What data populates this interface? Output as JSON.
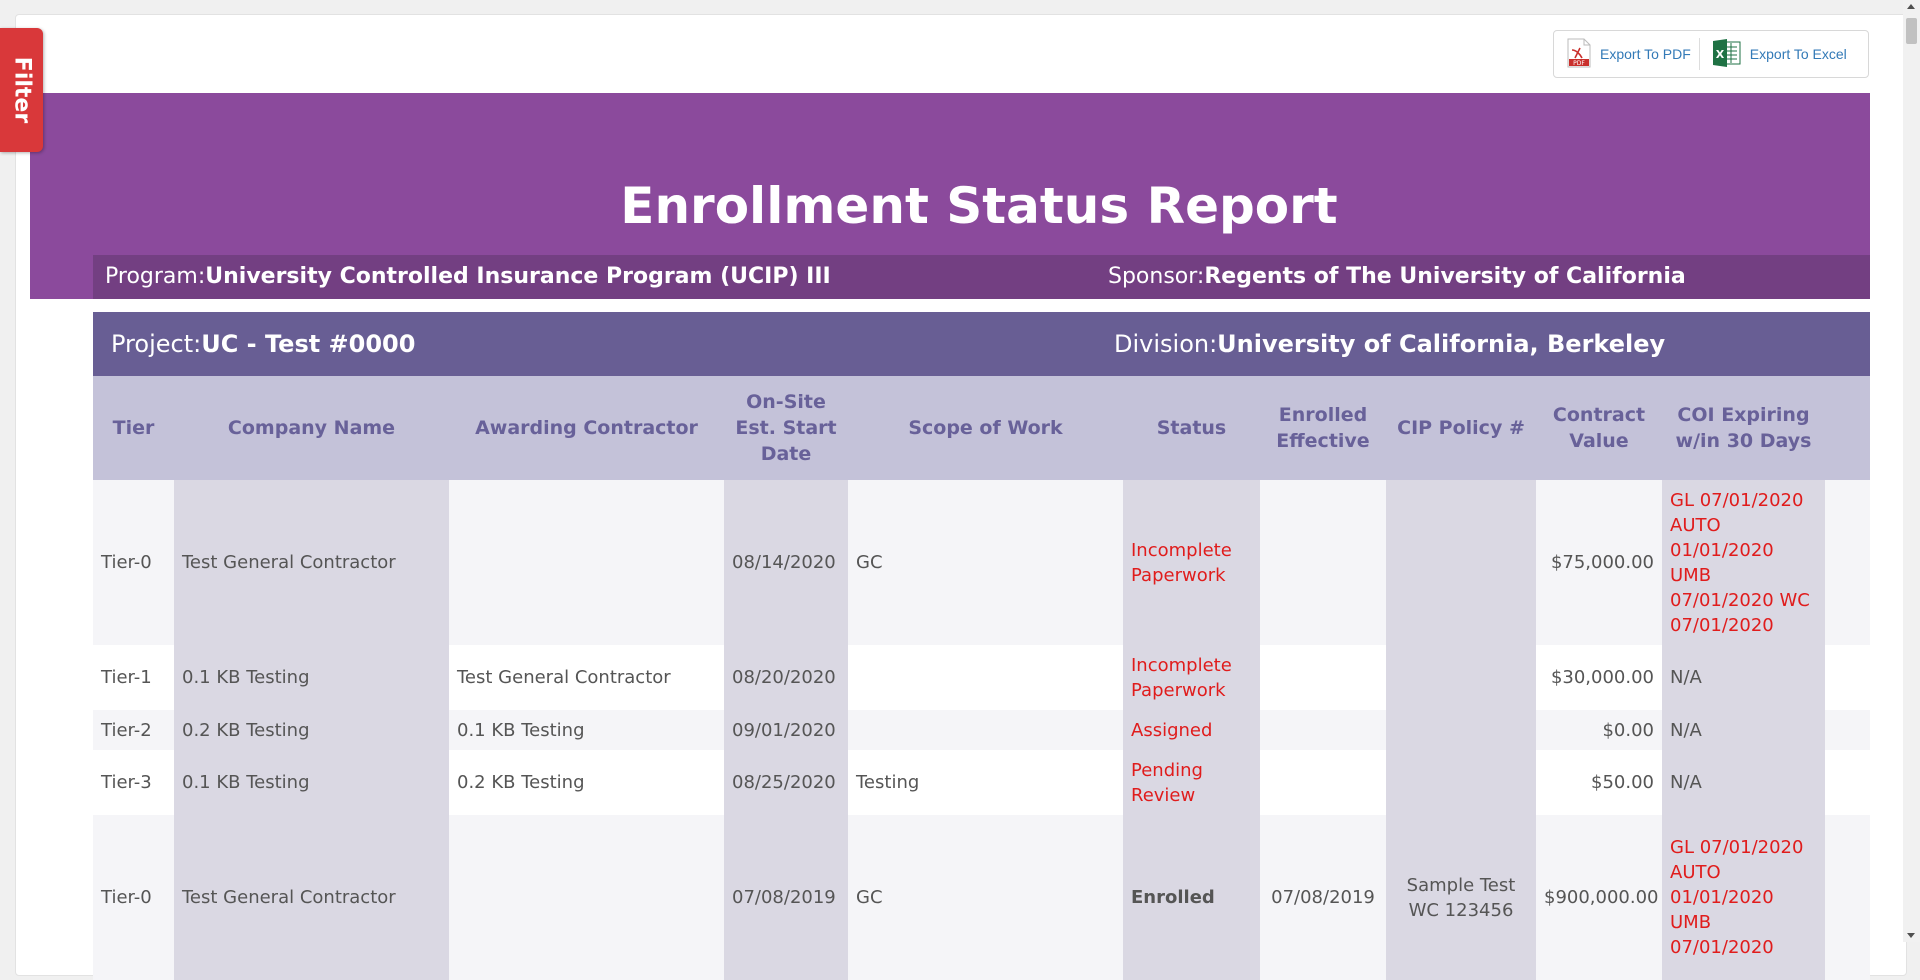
{
  "filter": {
    "label": "Filter"
  },
  "export": {
    "pdf_label": "Export To PDF",
    "excel_label": "Export To Excel"
  },
  "report": {
    "title": "Enrollment Status Report",
    "program_label": "Program:",
    "program_value": "University Controlled Insurance Program (UCIP) III",
    "sponsor_label": "Sponsor:",
    "sponsor_value": "Regents of The University of California",
    "project_label": "Project:",
    "project_value": "UC - Test #0000",
    "division_label": "Division:",
    "division_value": "University of California, Berkeley"
  },
  "table": {
    "headers": [
      "Tier",
      "Company Name",
      "Awarding Contractor",
      "On-Site Est. Start Date",
      "Scope of Work",
      "Status",
      "Enrolled Effective",
      "CIP Policy #",
      "Contract Value",
      "COI Expiring w/in 30 Days"
    ],
    "rows": [
      {
        "tier": "Tier-0",
        "company": "Test General Contractor",
        "awarding": "",
        "start": "08/14/2020",
        "scope": "GC",
        "status": "Incomplete Paperwork",
        "enrolled": "",
        "policy": "",
        "value": "$75,000.00",
        "coi": "GL 07/01/2020 AUTO 01/01/2020 UMB 07/01/2020 WC 07/01/2020"
      },
      {
        "tier": "Tier-1",
        "company": "0.1 KB Testing",
        "awarding": "Test General Contractor",
        "start": "08/20/2020",
        "scope": "",
        "status": "Incomplete Paperwork",
        "enrolled": "",
        "policy": "",
        "value": "$30,000.00",
        "coi": "N/A"
      },
      {
        "tier": "Tier-2",
        "company": "0.2 KB Testing",
        "awarding": "0.1 KB Testing",
        "start": "09/01/2020",
        "scope": "",
        "status": "Assigned",
        "enrolled": "",
        "policy": "",
        "value": "$0.00",
        "coi": "N/A"
      },
      {
        "tier": "Tier-3",
        "company": "0.1 KB Testing",
        "awarding": "0.2 KB Testing",
        "start": "08/25/2020",
        "scope": "Testing",
        "status": "Pending Review",
        "enrolled": "",
        "policy": "",
        "value": "$50.00",
        "coi": "N/A"
      },
      {
        "tier": "Tier-0",
        "company": "Test General Contractor",
        "awarding": "",
        "start": "07/08/2019",
        "scope": "GC",
        "status": "Enrolled",
        "enrolled": "07/08/2019",
        "policy": "Sample Test WC 123456",
        "value": "$900,000.00",
        "coi": "GL 07/01/2020 AUTO 01/01/2020 UMB 07/01/2020"
      }
    ]
  }
}
